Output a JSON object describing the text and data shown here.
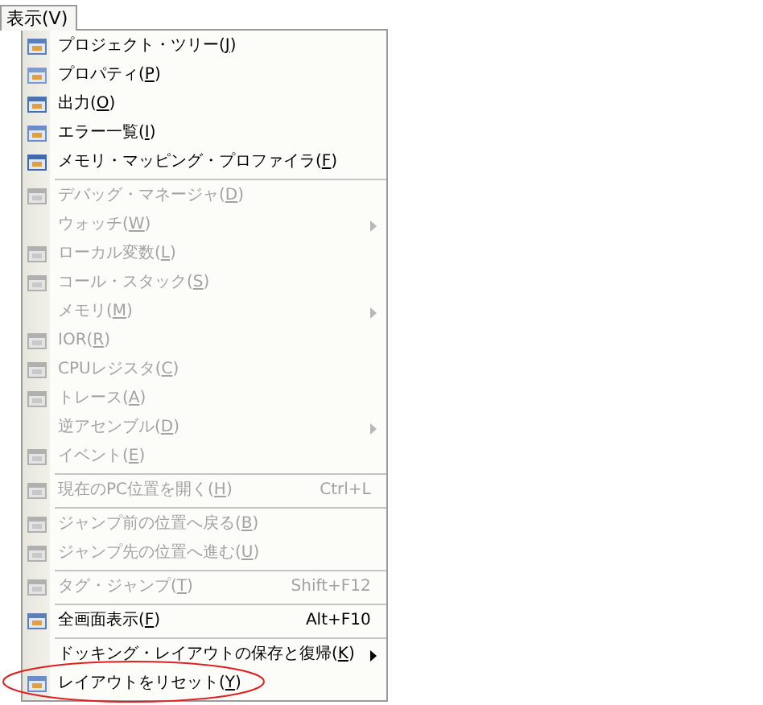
{
  "menu_bar": {
    "title": "表示(V)",
    "selected": true
  },
  "menu": {
    "items": [
      {
        "kind": "item",
        "label": "プロジェクト・ツリー(J)",
        "icon": true,
        "disabled": false
      },
      {
        "kind": "item",
        "label": "プロパティ(P)",
        "icon": true,
        "disabled": false
      },
      {
        "kind": "item",
        "label": "出力(O)",
        "icon": true,
        "disabled": false
      },
      {
        "kind": "item",
        "label": "エラー一覧(I)",
        "icon": true,
        "disabled": false
      },
      {
        "kind": "item",
        "label": "メモリ・マッピング・プロファイラ(F)",
        "icon": true,
        "disabled": false
      },
      {
        "kind": "separator"
      },
      {
        "kind": "item",
        "label": "デバッグ・マネージャ(D)",
        "icon": true,
        "disabled": true
      },
      {
        "kind": "item",
        "label": "ウォッチ(W)",
        "icon": false,
        "disabled": true,
        "submenu": true
      },
      {
        "kind": "item",
        "label": "ローカル変数(L)",
        "icon": true,
        "disabled": true
      },
      {
        "kind": "item",
        "label": "コール・スタック(S)",
        "icon": true,
        "disabled": true
      },
      {
        "kind": "item",
        "label": "メモリ(M)",
        "icon": false,
        "disabled": true,
        "submenu": true
      },
      {
        "kind": "item",
        "label": "IOR(R)",
        "icon": true,
        "disabled": true
      },
      {
        "kind": "item",
        "label": "CPUレジスタ(C)",
        "icon": true,
        "disabled": true
      },
      {
        "kind": "item",
        "label": "トレース(A)",
        "icon": true,
        "disabled": true
      },
      {
        "kind": "item",
        "label": "逆アセンブル(D)",
        "icon": false,
        "disabled": true,
        "submenu": true
      },
      {
        "kind": "item",
        "label": "イベント(E)",
        "icon": true,
        "disabled": true
      },
      {
        "kind": "separator"
      },
      {
        "kind": "item",
        "label": "現在のPC位置を開く(H)",
        "shortcut": "Ctrl+L",
        "icon": true,
        "disabled": true
      },
      {
        "kind": "separator"
      },
      {
        "kind": "item",
        "label": "ジャンプ前の位置へ戻る(B)",
        "icon": true,
        "disabled": true
      },
      {
        "kind": "item",
        "label": "ジャンプ先の位置へ進む(U)",
        "icon": true,
        "disabled": true
      },
      {
        "kind": "separator"
      },
      {
        "kind": "item",
        "label": "タグ・ジャンプ(T)",
        "shortcut": "Shift+F12",
        "icon": true,
        "disabled": true
      },
      {
        "kind": "separator"
      },
      {
        "kind": "item",
        "label": "全画面表示(F)",
        "shortcut": "Alt+F10",
        "icon": true,
        "disabled": false
      },
      {
        "kind": "separator"
      },
      {
        "kind": "item",
        "label": "ドッキング・レイアウトの保存と復帰(K)",
        "icon": false,
        "disabled": false,
        "submenu": true
      },
      {
        "kind": "item",
        "label": "レイアウトをリセット(Y)",
        "icon": true,
        "disabled": false,
        "circled": true
      }
    ]
  }
}
